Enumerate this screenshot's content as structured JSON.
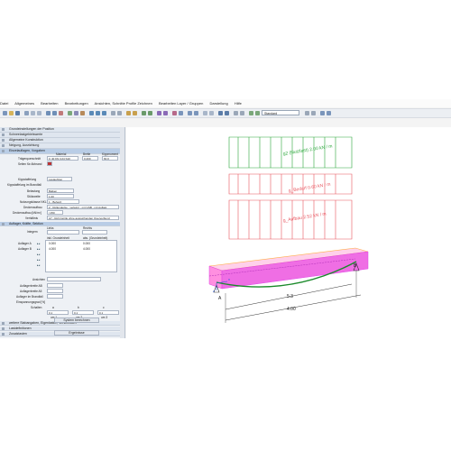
{
  "menu": {
    "items": [
      "Datei",
      "Allgemeines",
      "Bearbeiten",
      "Bearbeitungen",
      "Ansichten, Schnitte Profile Zeichnen",
      "Bearbeiten Layer / Gruppen",
      "Darstellung",
      "Hilfe"
    ]
  },
  "toolbar": {
    "view_select": "Standard"
  },
  "panel": {
    "sections": [
      {
        "label": "Grundeinstellungen der Position",
        "highlight": false
      },
      {
        "label": "Schneelastgebietswerte",
        "highlight": false
      },
      {
        "label": "Allgemeine Konstruktion",
        "highlight": false
      },
      {
        "label": "Neigung, Ausrichtung",
        "highlight": false
      },
      {
        "label": "Einzelauflagen, Vorgaben",
        "highlight": true
      }
    ],
    "col_material": "Material",
    "col_breite": "Breite",
    "col_kippmoment": "Kippmoment",
    "traegerquerschnitt_label": "Trägerquerschnitt",
    "traegerquerschnitt_value": "C 40 KN C24 S10",
    "breite_value": "0.200",
    "kipp_value": "60.0",
    "seiten_label": "Seiten für Abbrand",
    "kippstaebe_label": "Kippstaffelung",
    "kippstaebe_value": "Lastauftrag",
    "kippstaebe_unten_label": "Kippstaffelung im Brandfall",
    "belastung_label": "Belastung",
    "belastung_value": "Balken",
    "stuetzweite_label": "Stützweite",
    "stuetzweite_value": "1.00",
    "nutzungsklasse_label": "Nutzungsklasse NKL",
    "nutzungsklasse_value": "1 - Beheizt",
    "dachlast_label": "Deckenaufbau",
    "dachlast_value": "2 - Rollendecke - verleimt - mit GSB - mit Auflast",
    "grenzzustand_label": "Deckenaufbau [kN/m²]",
    "grenzzustand_value": "/ 250",
    "verhaeltnis_label": "Verhältnis",
    "verhaeltnis_value": "A7 - Rohrmörtle ohne ausreichenden Querverbund",
    "auflager_section": "Auflager, Kräfte, Sektion",
    "auflager_integer_label": "Integern",
    "auflager_links_label": "Links",
    "auflager_rechts_label": "Rechts",
    "auflager_grund_label": "inkl. Grundeinheit",
    "auflager_abs_label": "abs. (Grundeinheit)",
    "auflager_rows": [
      {
        "label": "Auflager A",
        "v1": "0.000",
        "v2": "0.000"
      },
      {
        "label": "Auflager B",
        "v1": "4.000",
        "v2": "4.000"
      }
    ],
    "form_labels": [
      "Ansichten",
      "Auflagerbreite AB",
      "Auflagerbreite A5",
      "Auflager im Brandfall",
      "Einspannungsgrad [%]",
      "Schalten"
    ],
    "grid_header": [
      "a",
      "b",
      "c"
    ],
    "grid_row1": [
      "0.1",
      "0.1",
      "0.1"
    ],
    "grid_row2": [
      "um 1",
      "um 2",
      "um 3"
    ],
    "bottom_sections": [
      "weitere Stabangaben, Eigenlasten, Verschnitten",
      "Lastdefinitionen",
      "Zusatzlasten"
    ],
    "berechnen_button": "System berechnen",
    "ergebnisse_button": "Ergebnisse"
  },
  "drawing": {
    "load1": "g2 (Nutzlast) 2.00 kN / m",
    "load2": "g_Bedarf 0.60 kN / m",
    "load3": "g_Aufbau 2.52 kN / m",
    "dim_inner": "5.3",
    "dim_outer": "4.00",
    "point_a": "A",
    "point_b": "B",
    "axis_x": "x",
    "axis_z": "z",
    "colors": {
      "green": "#2aa73a",
      "red": "#e8545e",
      "magenta": "#e040e8",
      "beam": "#ff9ad8"
    }
  }
}
